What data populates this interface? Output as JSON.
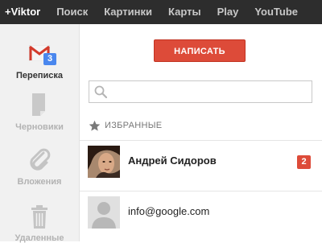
{
  "topbar": {
    "links": [
      {
        "label": "+Viktor"
      },
      {
        "label": "Поиск"
      },
      {
        "label": "Картинки"
      },
      {
        "label": "Карты"
      },
      {
        "label": "Play"
      },
      {
        "label": "YouTube"
      }
    ]
  },
  "sidebar": {
    "items": [
      {
        "label": "Переписка",
        "icon": "gmail-icon",
        "badge": "3",
        "active": true
      },
      {
        "label": "Черновики",
        "icon": "draft-icon"
      },
      {
        "label": "Вложения",
        "icon": "paperclip-icon"
      },
      {
        "label": "Удаленные",
        "icon": "trash-icon"
      }
    ]
  },
  "main": {
    "compose_label": "НАПИСАТЬ",
    "search": {
      "value": "",
      "placeholder": ""
    },
    "favorites_header": "ИЗБРАННЫЕ",
    "contacts": [
      {
        "name": "Андрей Сидоров",
        "badge": "2",
        "avatar": "photo-avatar"
      },
      {
        "name": "info@google.com",
        "avatar": "default-avatar"
      }
    ]
  },
  "colors": {
    "topbar_bg": "#2d2d2d",
    "compose_red": "#dd4b39",
    "badge_blue": "#4a87ee",
    "badge_red": "#dd4b39",
    "sidebar_bg": "#f1f1f1"
  }
}
